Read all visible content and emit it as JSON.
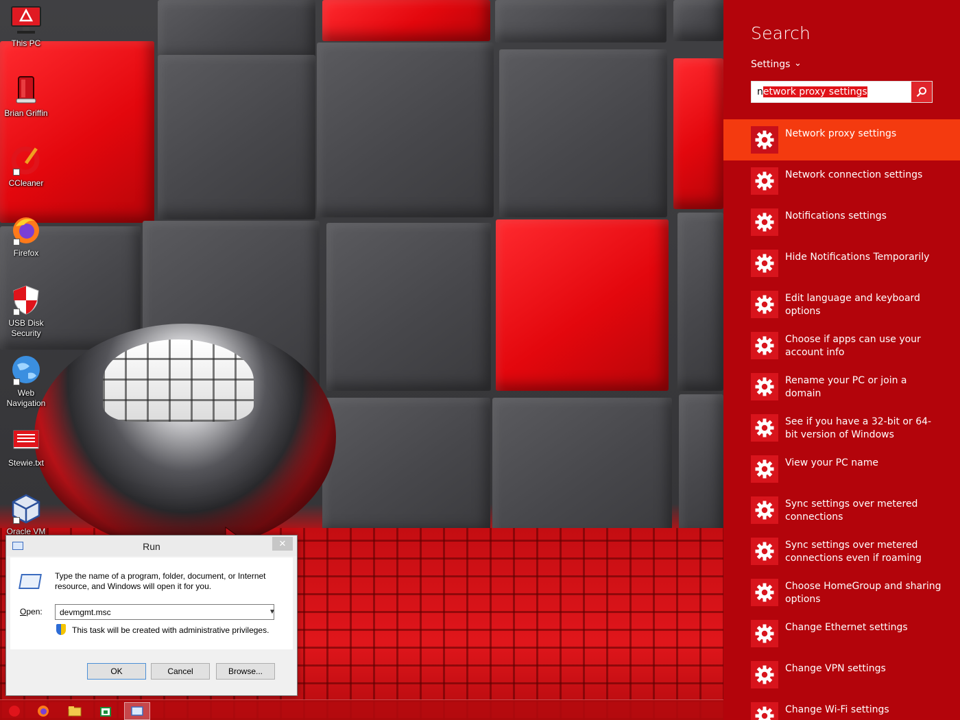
{
  "desktop": {
    "icons": [
      {
        "label": "This PC"
      },
      {
        "label": "Brian Griffin"
      },
      {
        "label": "CCleaner"
      },
      {
        "label": "Firefox"
      },
      {
        "label": "USB Disk Security"
      },
      {
        "label": "Web Navigation"
      },
      {
        "label": "Stewie.txt"
      },
      {
        "label": "Oracle VM"
      }
    ]
  },
  "run_dialog": {
    "title": "Run",
    "description": "Type the name of a program, folder, document, or Internet resource, and Windows will open it for you.",
    "open_label": "Open:",
    "open_value": "devmgmt.msc",
    "admin_note": "This task will be created with administrative privileges.",
    "ok_label": "OK",
    "cancel_label": "Cancel",
    "browse_label": "Browse..."
  },
  "search_charm": {
    "title": "Search",
    "scope": "Settings",
    "query_first": "n",
    "query_selected": "etwork proxy settings",
    "accent_color": "#b3040b",
    "active_color": "#f43a0f",
    "results": [
      {
        "label": "Network proxy settings",
        "icon": "gear-icon"
      },
      {
        "label": "Network connection settings",
        "icon": "gear-icon"
      },
      {
        "label": "Notifications settings",
        "icon": "gear-icon"
      },
      {
        "label": "Hide Notifications Temporarily",
        "icon": "gear-icon"
      },
      {
        "label": "Edit language and keyboard options",
        "icon": "gear-icon"
      },
      {
        "label": "Choose if apps can use your account info",
        "icon": "gear-icon"
      },
      {
        "label": "Rename your PC or join a domain",
        "icon": "gear-icon"
      },
      {
        "label": "See if you have a 32-bit or 64-bit version of Windows",
        "icon": "gear-icon"
      },
      {
        "label": "View your PC name",
        "icon": "gear-icon"
      },
      {
        "label": "Sync settings over metered connections",
        "icon": "gear-icon"
      },
      {
        "label": "Sync settings over metered connections even if roaming",
        "icon": "gear-icon"
      },
      {
        "label": "Choose HomeGroup and sharing options",
        "icon": "gear-icon"
      },
      {
        "label": "Change Ethernet settings",
        "icon": "gear-icon"
      },
      {
        "label": "Change VPN settings",
        "icon": "gear-icon"
      },
      {
        "label": "Change Wi-Fi settings",
        "icon": "gear-icon"
      }
    ]
  },
  "taskbar": {
    "items": [
      "start-icon",
      "firefox-icon",
      "file-explorer-icon",
      "store-icon",
      "run-icon"
    ]
  }
}
